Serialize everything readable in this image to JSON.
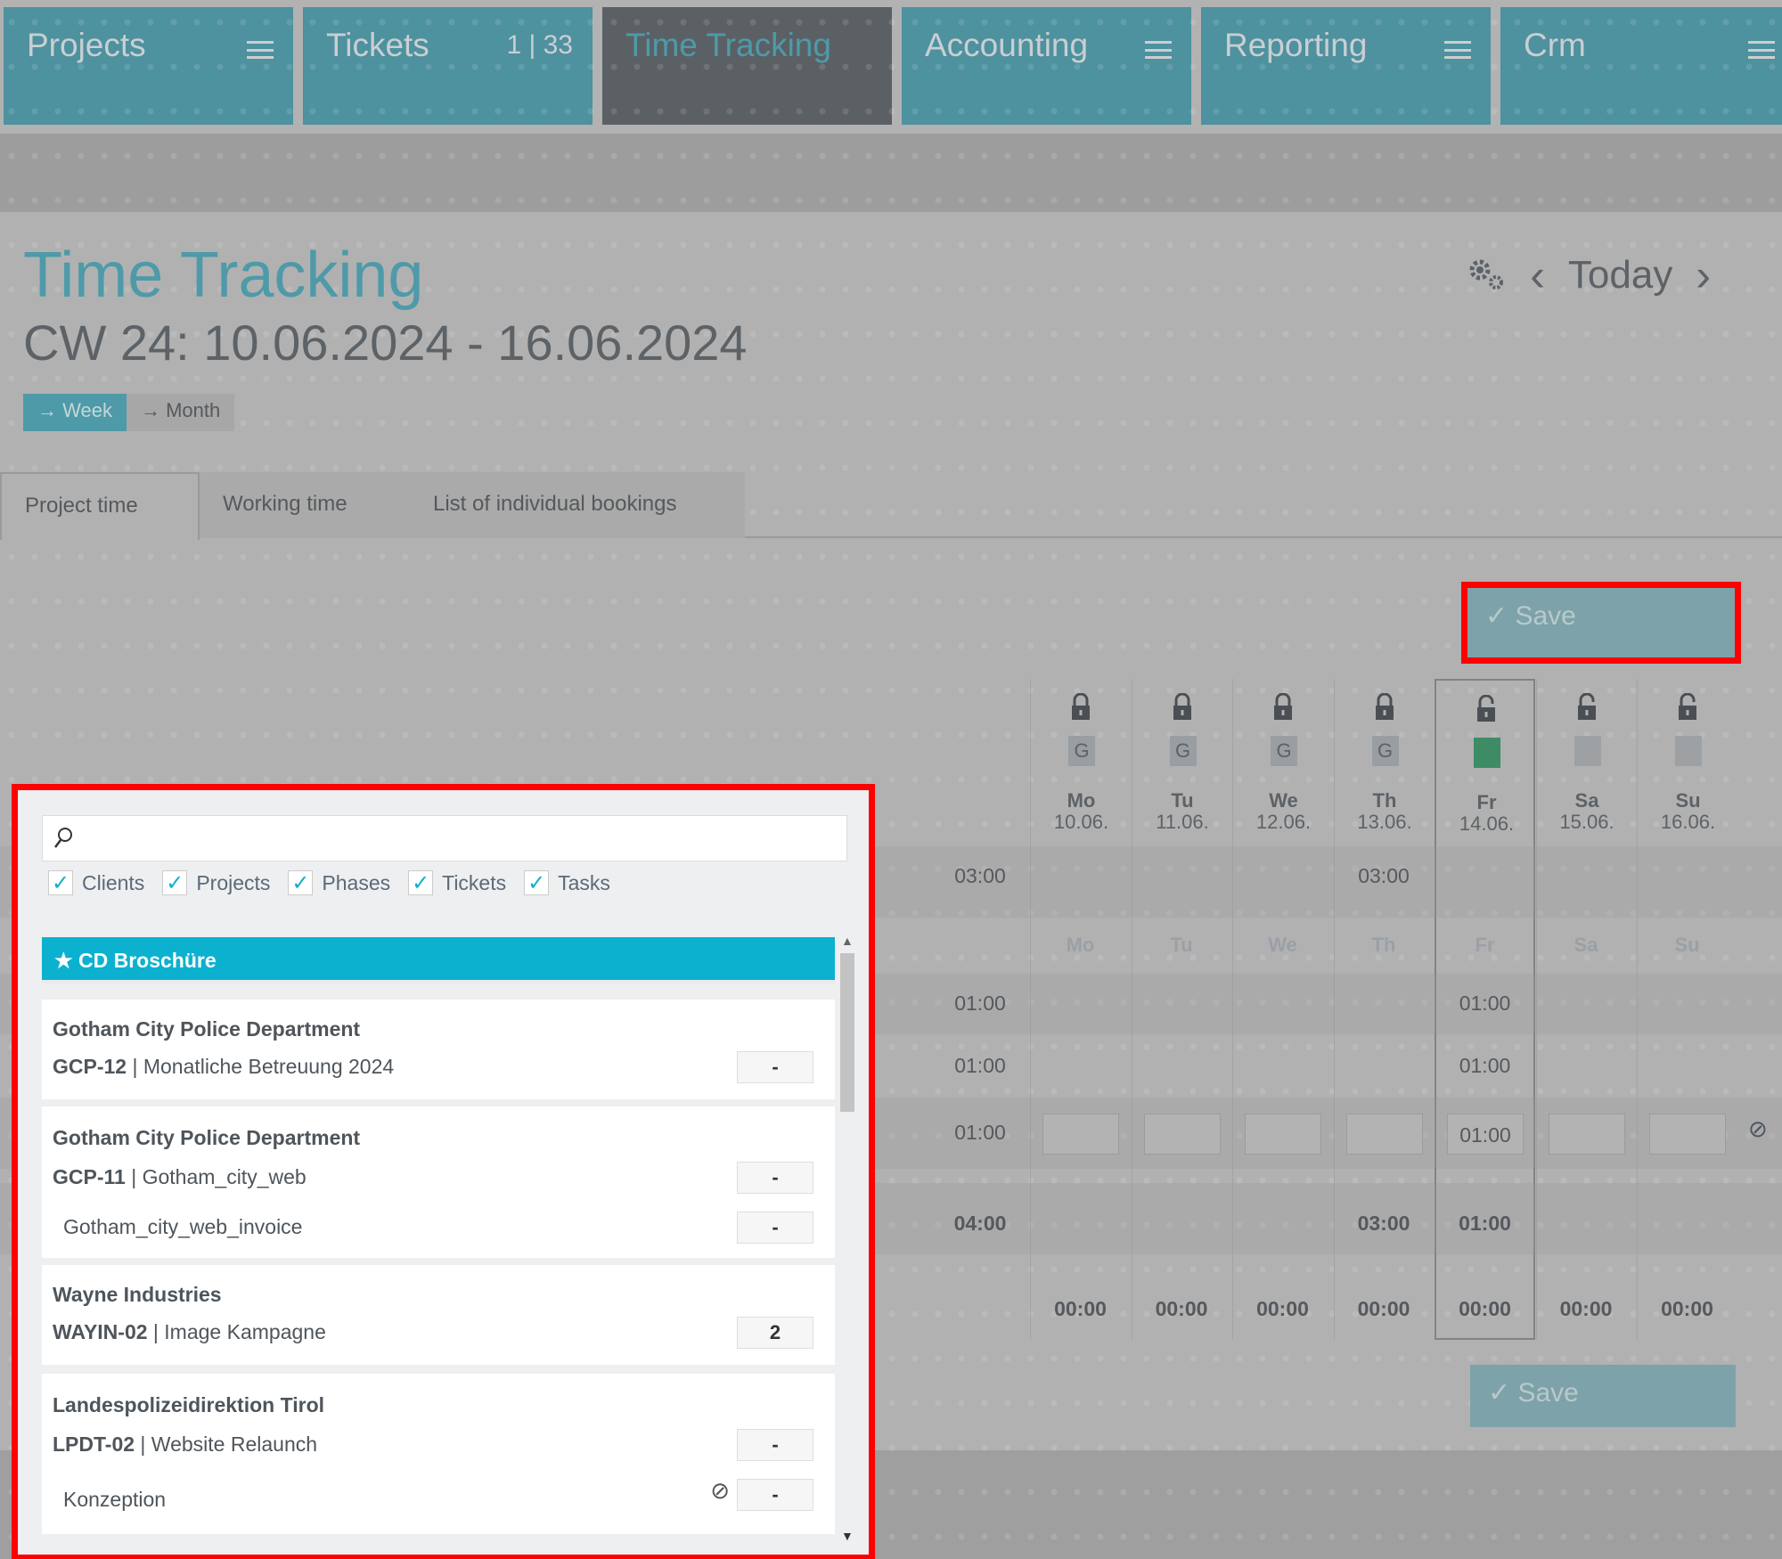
{
  "nav": {
    "tabs": [
      {
        "label": "Projects",
        "badge": "",
        "icon": "menu-icon",
        "active": false
      },
      {
        "label": "Tickets",
        "badge": "1 | 33",
        "icon": "",
        "active": false
      },
      {
        "label": "Time Tracking",
        "badge": "",
        "icon": "",
        "active": true
      },
      {
        "label": "Accounting",
        "badge": "",
        "icon": "menu-icon",
        "active": false
      },
      {
        "label": "Reporting",
        "badge": "",
        "icon": "menu-icon",
        "active": false
      },
      {
        "label": "Crm",
        "badge": "",
        "icon": "menu-icon",
        "active": false
      }
    ]
  },
  "header": {
    "title": "Time Tracking",
    "subtitle": "CW 24: 10.06.2024 - 16.06.2024",
    "today_label": "Today",
    "prev_icon": "chevron-left-icon",
    "next_icon": "chevron-right-icon",
    "settings_icon": "gears-icon"
  },
  "view_toggle": {
    "week": "→ Week",
    "month": "→ Month",
    "selected": "week"
  },
  "tabs": [
    {
      "label": "Project time",
      "active": true
    },
    {
      "label": "Working time",
      "active": false
    },
    {
      "label": "List of individual bookings",
      "active": false
    }
  ],
  "save_label": "✓ Save",
  "days": [
    {
      "name": "Mo",
      "date": "10.06.",
      "status": "G",
      "status_color": "#999ea2",
      "locked": true
    },
    {
      "name": "Tu",
      "date": "11.06.",
      "status": "G",
      "status_color": "#999ea2",
      "locked": true
    },
    {
      "name": "We",
      "date": "12.06.",
      "status": "G",
      "status_color": "#999ea2",
      "locked": true
    },
    {
      "name": "Th",
      "date": "13.06.",
      "status": "G",
      "status_color": "#999ea2",
      "locked": true
    },
    {
      "name": "Fr",
      "date": "14.06.",
      "status": "",
      "status_color": "#3d8c66",
      "locked": false,
      "current": true
    },
    {
      "name": "Sa",
      "date": "15.06.",
      "status": "",
      "status_color": "#9ea1a4",
      "locked": false
    },
    {
      "name": "Su",
      "date": "16.06.",
      "status": "",
      "status_color": "#9ea1a4",
      "locked": false
    }
  ],
  "rows": {
    "row1": {
      "total": "03:00",
      "values": [
        "",
        "",
        "",
        "03:00",
        "",
        "",
        ""
      ]
    },
    "ghost_header": [
      "Mo",
      "Tu",
      "We",
      "Th",
      "Fr",
      "Sa",
      "Su"
    ],
    "row2": {
      "total": "01:00",
      "values": [
        "",
        "",
        "",
        "",
        "01:00",
        "",
        ""
      ]
    },
    "row3": {
      "total": "01:00",
      "values": [
        "",
        "",
        "",
        "",
        "01:00",
        "",
        ""
      ]
    },
    "row4": {
      "total": "01:00",
      "inputs": [
        "",
        "",
        "",
        "",
        "01:00",
        "",
        ""
      ]
    },
    "sum": {
      "total": "04:00",
      "values": [
        "",
        "",
        "",
        "03:00",
        "01:00",
        "",
        ""
      ]
    },
    "balance": {
      "values": [
        "00:00",
        "00:00",
        "00:00",
        "00:00",
        "00:00",
        "00:00",
        "00:00"
      ]
    }
  },
  "popup": {
    "search_placeholder": "",
    "filters": [
      {
        "label": "Clients",
        "checked": true
      },
      {
        "label": "Projects",
        "checked": true
      },
      {
        "label": "Phases",
        "checked": true
      },
      {
        "label": "Tickets",
        "checked": true
      },
      {
        "label": "Tasks",
        "checked": true
      }
    ],
    "pinned": "★ CD Broschüre",
    "cards": [
      {
        "client": "Gotham City Police Department",
        "code": "GCP-12",
        "project": "Monatliche Betreuung 2024",
        "value": "-",
        "subs": []
      },
      {
        "client": "Gotham City Police Department",
        "code": "GCP-11",
        "project": "Gotham_city_web",
        "value": "-",
        "subs": [
          {
            "label": "Gotham_city_web_invoice",
            "value": "-"
          }
        ]
      },
      {
        "client": "Wayne Industries",
        "code": "WAYIN-02",
        "project": "Image Kampagne",
        "value": "2",
        "subs": []
      },
      {
        "client": "Landespolizeidirektion Tirol",
        "code": "LPDT-02",
        "project": "Website Relaunch",
        "value": "-",
        "subs": [
          {
            "label": "Konzeption",
            "value": "-",
            "blocked": true
          }
        ]
      }
    ]
  }
}
